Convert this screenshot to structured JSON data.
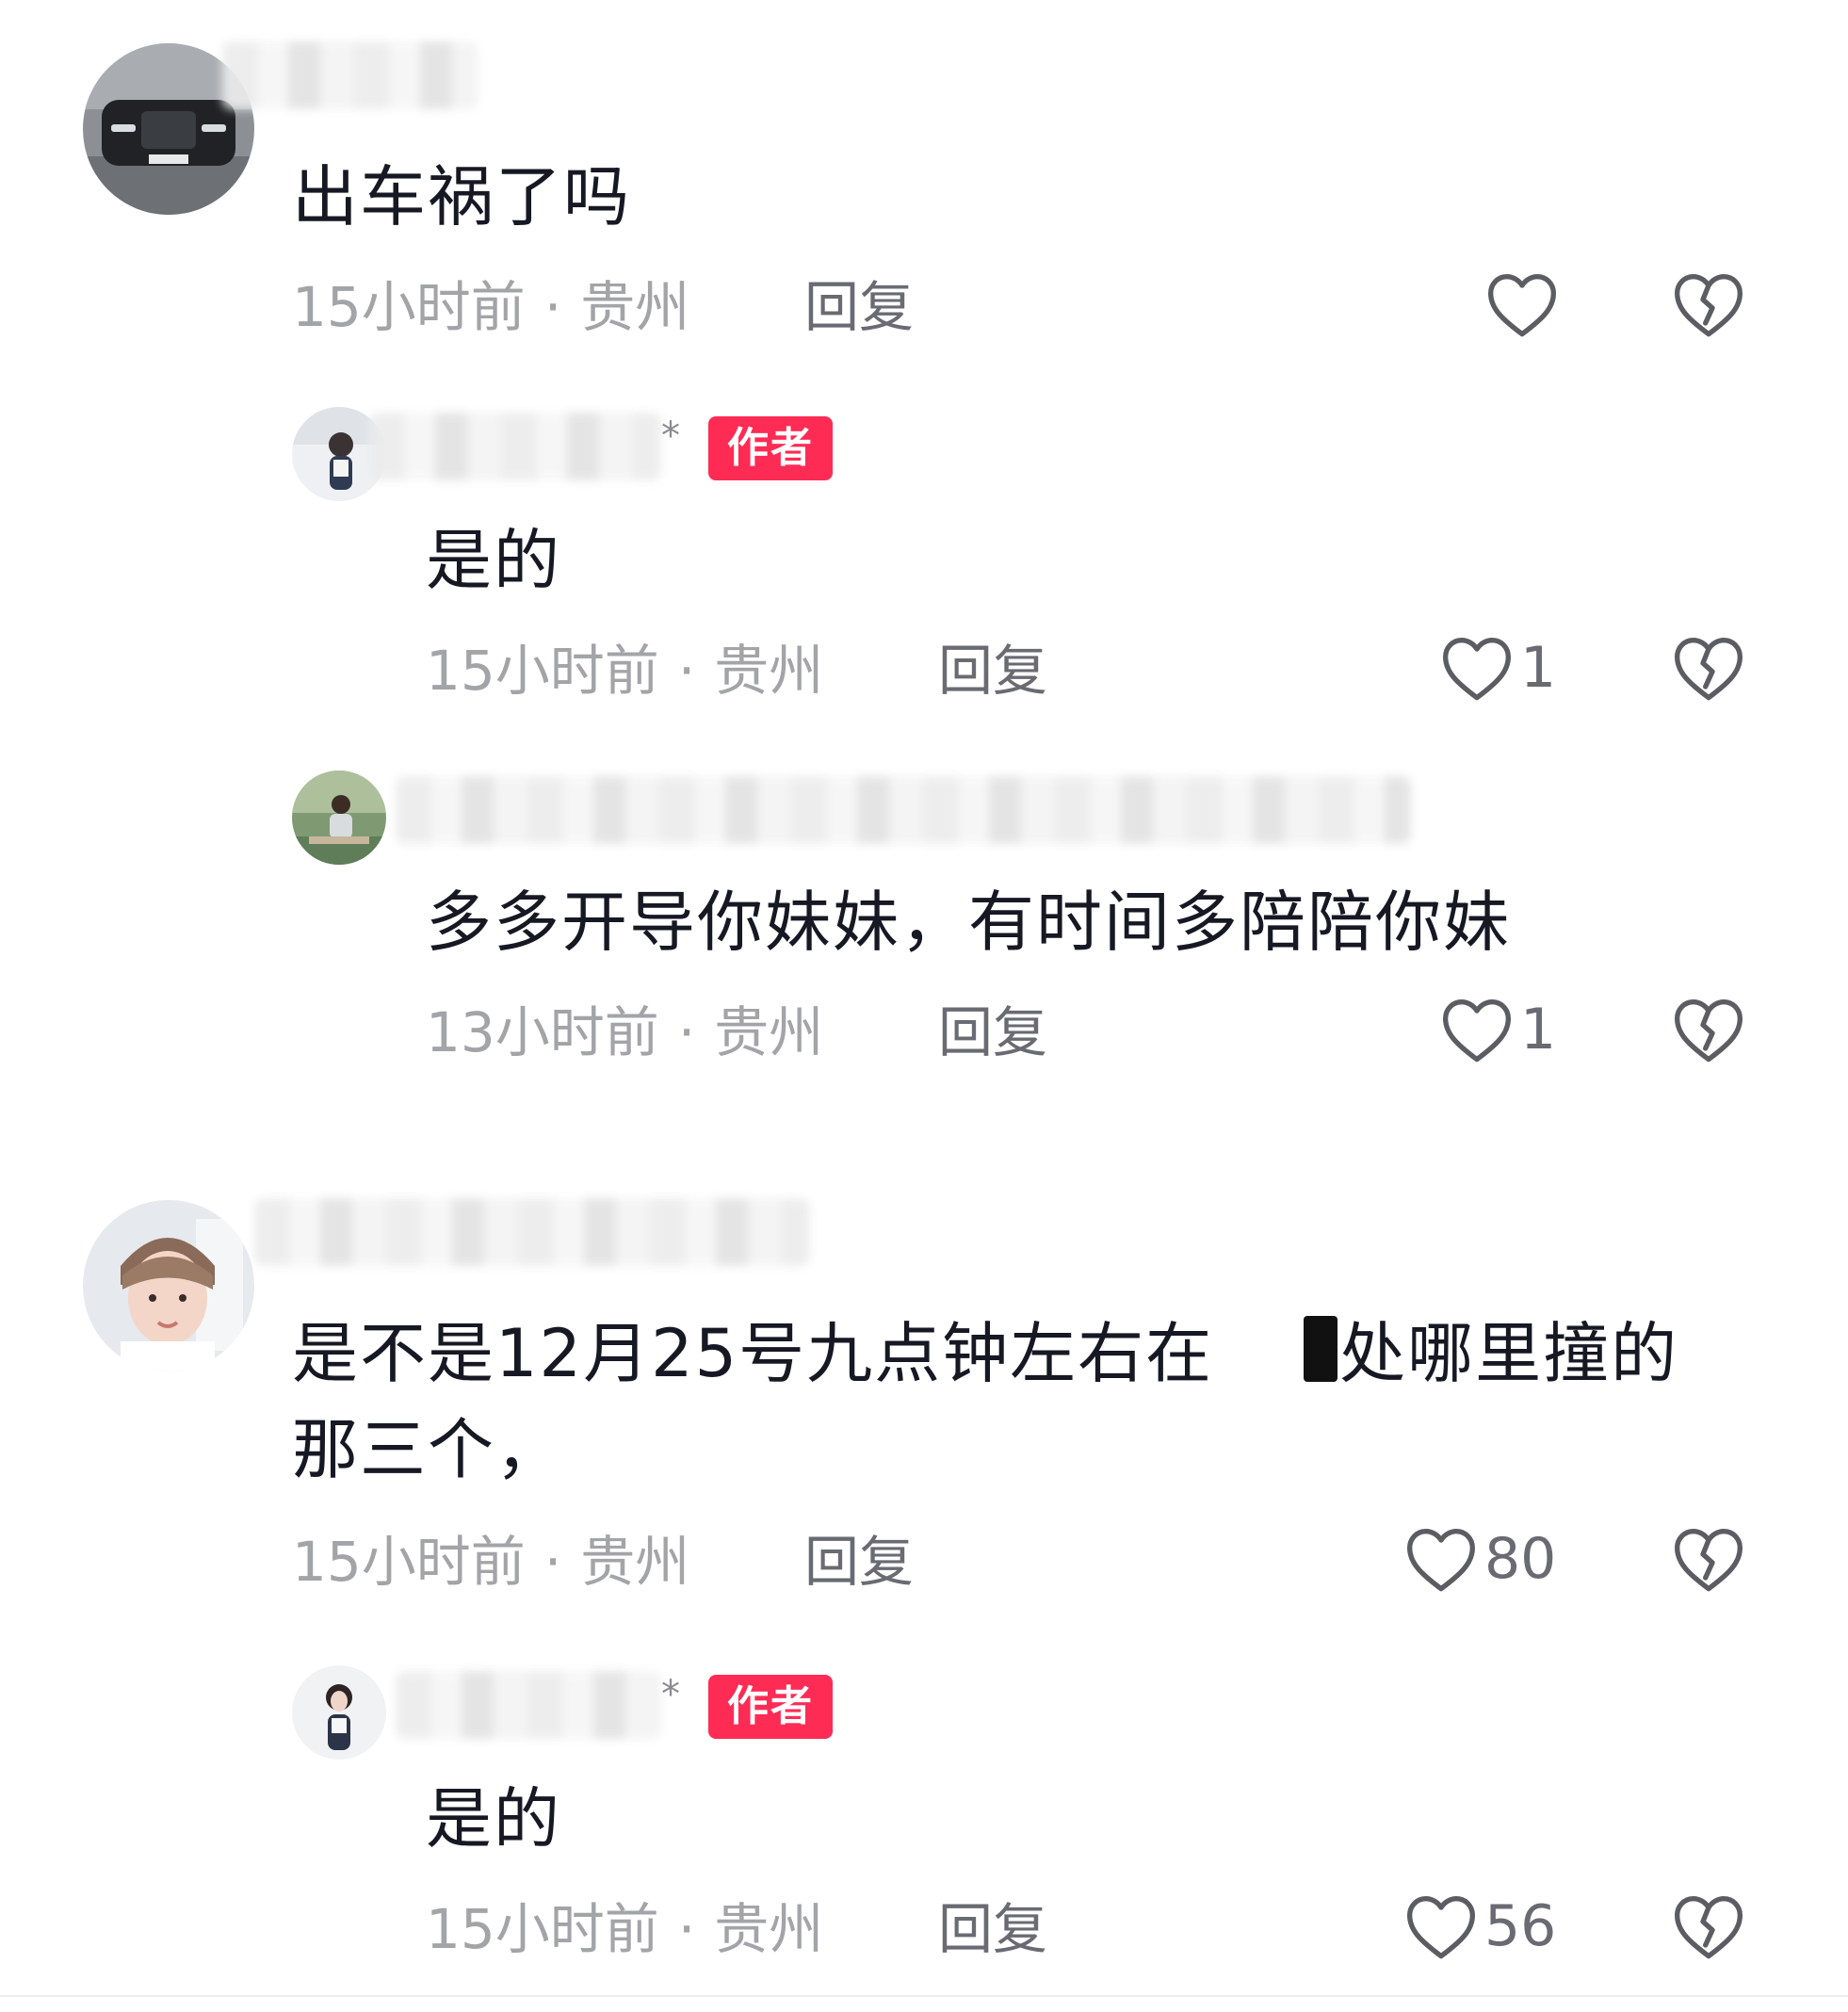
{
  "comments": [
    {
      "content": "出车祸了吗",
      "time": "15小时前",
      "location": "贵州",
      "reply_label": "回复",
      "likes": ""
    },
    {
      "content": "是的",
      "author_tag": "作者",
      "name_suffix": "*",
      "time": "15小时前",
      "location": "贵州",
      "reply_label": "回复",
      "likes": "1"
    },
    {
      "content": "多多开导你妹妹，有时间多陪陪你妹",
      "time": "13小时前",
      "location": "贵州",
      "reply_label": "回复",
      "likes": "1"
    },
    {
      "content_part1": "是不是12月25号九点钟左右在",
      "content_part2": "处哪里撞的",
      "content_line2": "那三个，",
      "time": "15小时前",
      "location": "贵州",
      "reply_label": "回复",
      "likes": "80"
    },
    {
      "content": "是的",
      "author_tag": "作者",
      "name_suffix": "*",
      "time": "15小时前",
      "location": "贵州",
      "reply_label": "回复",
      "likes": "56"
    }
  ],
  "meta_separator": "·",
  "colors": {
    "author_tag": "#fe2c55",
    "meta_text": "#a3a4a8",
    "icon_stroke": "#5c5d63"
  },
  "icons": {
    "like": "heart-outline-icon",
    "dislike": "broken-heart-icon"
  }
}
